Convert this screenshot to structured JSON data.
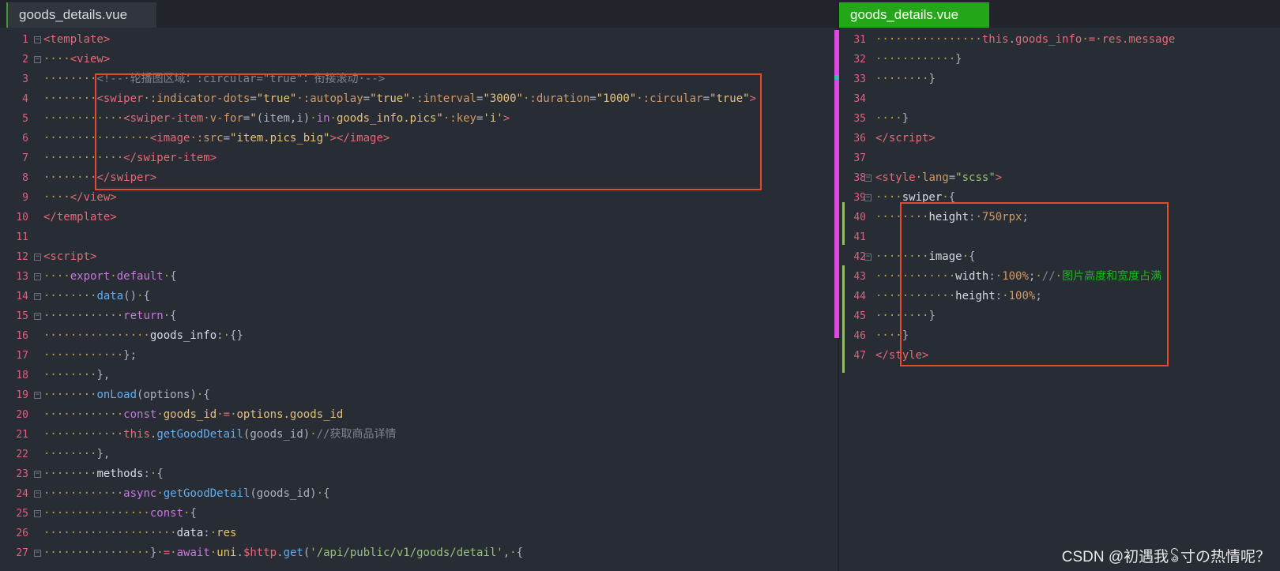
{
  "left_editor": {
    "tab_title": "goods_details.vue",
    "lines": [
      {
        "n": "1",
        "fold": true,
        "html": "<span class=\"tag\">&lt;template&gt;</span>"
      },
      {
        "n": "2",
        "fold": true,
        "html": "<span class=\"dot\">····</span><span class=\"tag\">&lt;view&gt;</span>"
      },
      {
        "n": "3",
        "fold": false,
        "html": "<span class=\"dot\">········</span><span class=\"cmt\">&lt;!--·轮播图区域：:circular=\"true\"：衔接滚动·--&gt;</span>"
      },
      {
        "n": "4",
        "fold": false,
        "html": "<span class=\"dot\">········</span><span class=\"tag\">&lt;swiper</span><span class=\"dot\">·</span><span class=\"attr\">:indicator-dots</span>=<span class=\"str\">\"true\"</span><span class=\"dot\">·</span><span class=\"attr\">:autoplay</span>=<span class=\"str\">\"true\"</span><span class=\"dot\">·</span><span class=\"attr\">:interval</span>=<span class=\"str\">\"3000\"</span><span class=\"dot\">·</span><span class=\"attr\">:duration</span>=<span class=\"str\">\"1000\"</span><span class=\"dot\">·</span><span class=\"attr\">:circular</span>=<span class=\"str\">\"true\"</span><span class=\"tag\">&gt;</span>"
      },
      {
        "n": "5",
        "fold": false,
        "html": "<span class=\"dot\">············</span><span class=\"tag\">&lt;swiper-item</span><span class=\"dot\">·</span><span class=\"attr\">v-for</span>=<span class=\"str\">\"</span><span class=\"plain\">(item,i)</span><span class=\"dot\">·</span><span class=\"kw\">in</span><span class=\"dot\">·</span><span class=\"id\">goods_info.pics</span><span class=\"str\">\"</span><span class=\"dot\">·</span><span class=\"attr\">:key</span>=<span class=\"str\">'i'</span><span class=\"tag\">&gt;</span>"
      },
      {
        "n": "6",
        "fold": false,
        "html": "<span class=\"dot\">················</span><span class=\"tag\">&lt;image</span><span class=\"dot\">·</span><span class=\"attr\">:src</span>=<span class=\"str\">\"item.pics_big\"</span><span class=\"tag\">&gt;&lt;/image&gt;</span>"
      },
      {
        "n": "7",
        "fold": false,
        "html": "<span class=\"dot\">············</span><span class=\"tag\">&lt;/swiper-item&gt;</span>"
      },
      {
        "n": "8",
        "fold": false,
        "html": "<span class=\"dot\">········</span><span class=\"tag\">&lt;/swiper&gt;</span>"
      },
      {
        "n": "9",
        "fold": false,
        "html": "<span class=\"dot\">····</span><span class=\"tag\">&lt;/view&gt;</span>"
      },
      {
        "n": "10",
        "fold": false,
        "html": "<span class=\"tag\">&lt;/template&gt;</span>"
      },
      {
        "n": "11",
        "fold": false,
        "html": ""
      },
      {
        "n": "12",
        "fold": true,
        "html": "<span class=\"tag\">&lt;script&gt;</span>"
      },
      {
        "n": "13",
        "fold": true,
        "html": "<span class=\"dot\">····</span><span class=\"kw\">export</span><span class=\"dot\">·</span><span class=\"kw\">default</span><span class=\"dot\">·</span><span class=\"plain\">{</span>"
      },
      {
        "n": "14",
        "fold": true,
        "html": "<span class=\"dot\">········</span><span class=\"fn\">data</span><span class=\"plain\">()</span><span class=\"dot\">·</span><span class=\"plain\">{</span>"
      },
      {
        "n": "15",
        "fold": true,
        "html": "<span class=\"dot\">············</span><span class=\"kw\">return</span><span class=\"dot\">·</span><span class=\"plain\">{</span>"
      },
      {
        "n": "16",
        "fold": false,
        "html": "<span class=\"dot\">················</span><span class=\"prop\">goods_info</span><span class=\"plain\">:</span><span class=\"dot\">·</span><span class=\"plain\">{}</span>"
      },
      {
        "n": "17",
        "fold": false,
        "html": "<span class=\"dot\">············</span><span class=\"plain\">};</span>"
      },
      {
        "n": "18",
        "fold": false,
        "html": "<span class=\"dot\">········</span><span class=\"plain\">},</span>"
      },
      {
        "n": "19",
        "fold": true,
        "html": "<span class=\"dot\">········</span><span class=\"fn\">onLoad</span><span class=\"plain\">(options)</span><span class=\"dot\">·</span><span class=\"plain\">{</span>"
      },
      {
        "n": "20",
        "fold": false,
        "html": "<span class=\"dot\">············</span><span class=\"kw\">const</span><span class=\"dot\">·</span><span class=\"id\">goods_id</span><span class=\"dot\">·</span><span class=\"tag\">=</span><span class=\"dot\">·</span><span class=\"id\">options.goods_id</span>"
      },
      {
        "n": "21",
        "fold": false,
        "html": "<span class=\"dot\">············</span><span class=\"tag\">this</span><span class=\"plain\">.</span><span class=\"fn\">getGoodDetail</span><span class=\"plain\">(goods_id)</span><span class=\"dot\">·</span><span class=\"cmt\">//获取商品详情</span>"
      },
      {
        "n": "22",
        "fold": false,
        "html": "<span class=\"dot\">········</span><span class=\"plain\">},</span>"
      },
      {
        "n": "23",
        "fold": true,
        "html": "<span class=\"dot\">········</span><span class=\"prop\">methods</span><span class=\"plain\">:</span><span class=\"dot\">·</span><span class=\"plain\">{</span>"
      },
      {
        "n": "24",
        "fold": true,
        "html": "<span class=\"dot\">············</span><span class=\"kw\">async</span><span class=\"dot\">·</span><span class=\"fn\">getGoodDetail</span><span class=\"plain\">(goods_id)</span><span class=\"dot\">·</span><span class=\"plain\">{</span>"
      },
      {
        "n": "25",
        "fold": true,
        "html": "<span class=\"dot\">················</span><span class=\"kw\">const</span><span class=\"dot\">·</span><span class=\"plain\">{</span>"
      },
      {
        "n": "26",
        "fold": false,
        "html": "<span class=\"dot\">····················</span><span class=\"prop\">data</span><span class=\"plain\">:</span><span class=\"dot\">·</span><span class=\"id\">res</span>"
      },
      {
        "n": "27",
        "fold": true,
        "html": "<span class=\"dot\">················</span><span class=\"plain\">}</span><span class=\"dot\">·</span><span class=\"tag\">=</span><span class=\"dot\">·</span><span class=\"kw\">await</span><span class=\"dot\">·</span><span class=\"id\">uni</span><span class=\"plain\">.</span><span class=\"tag\">$http</span><span class=\"plain\">.</span><span class=\"fn\">get</span><span class=\"plain\">(</span><span class=\"url\">'/api/public/v1/goods/detail'</span><span class=\"plain\">,</span><span class=\"dot\">·</span><span class=\"plain\">{</span>"
      }
    ]
  },
  "right_editor": {
    "tab_title": "goods_details.vue",
    "lines": [
      {
        "n": "31",
        "fold": false,
        "html": "<span class=\"dot\">················</span><span class=\"tag\">this</span><span class=\"plain\">.</span><span class=\"tag\">goods_info</span><span class=\"dot\">·</span><span class=\"tag\">=</span><span class=\"dot\">·</span><span class=\"tag\">res.message</span>"
      },
      {
        "n": "32",
        "fold": false,
        "html": "<span class=\"dot\">············</span><span class=\"plain\">}</span>"
      },
      {
        "n": "33",
        "fold": false,
        "html": "<span class=\"dot\">········</span><span class=\"plain\">}</span>"
      },
      {
        "n": "34",
        "fold": false,
        "html": ""
      },
      {
        "n": "35",
        "fold": false,
        "html": "<span class=\"dot\">····</span><span class=\"plain\">}</span>"
      },
      {
        "n": "36",
        "fold": false,
        "html": "<span class=\"tag\">&lt;/script&gt;</span>"
      },
      {
        "n": "37",
        "fold": false,
        "html": ""
      },
      {
        "n": "38",
        "fold": true,
        "html": "<span class=\"tag\">&lt;style</span><span class=\"dot\">·</span><span class=\"attr\">lang</span>=<span class=\"url\">\"scss\"</span><span class=\"tag\">&gt;</span>"
      },
      {
        "n": "39",
        "fold": true,
        "html": "<span class=\"dot\">····</span><span class=\"prop\">swiper</span><span class=\"dot\">·</span><span class=\"plain\">{</span>"
      },
      {
        "n": "40",
        "fold": false,
        "html": "<span class=\"dot\">········</span><span class=\"prop\">height</span><span class=\"plain\">:</span><span class=\"dot\">·</span><span class=\"num\">750rpx</span><span class=\"plain\">;</span>"
      },
      {
        "n": "41",
        "fold": false,
        "html": ""
      },
      {
        "n": "42",
        "fold": true,
        "html": "<span class=\"dot\">········</span><span class=\"prop\">image</span><span class=\"dot\">·</span><span class=\"plain\">{</span>"
      },
      {
        "n": "43",
        "fold": false,
        "html": "<span class=\"dot\">············</span><span class=\"prop\">width</span><span class=\"plain\">:</span><span class=\"dot\">·</span><span class=\"num\">100%</span><span class=\"plain\">;</span><span class=\"dot\">·</span><span class=\"cmt\">//</span><span class=\"dot\">·</span><span class=\"cmt-green\">图片高度和宽度占满</span>"
      },
      {
        "n": "44",
        "fold": false,
        "html": "<span class=\"dot\">············</span><span class=\"prop\">height</span><span class=\"plain\">:</span><span class=\"dot\">·</span><span class=\"num\">100%</span><span class=\"plain\">;</span>"
      },
      {
        "n": "45",
        "fold": false,
        "html": "<span class=\"dot\">········</span><span class=\"plain\">}</span>"
      },
      {
        "n": "46",
        "fold": false,
        "html": "<span class=\"dot\">····</span><span class=\"plain\">}</span>"
      },
      {
        "n": "47",
        "fold": false,
        "html": "<span class=\"tag\">&lt;/style&gt;</span>"
      }
    ]
  },
  "watermark": "CSDN @初遇我ꂢ寸の热情呢？",
  "colors": {
    "background": "#282c34",
    "highlight_box": "#e14d2a",
    "active_tab": "#23a718",
    "line_numbers": "#e0607e"
  }
}
